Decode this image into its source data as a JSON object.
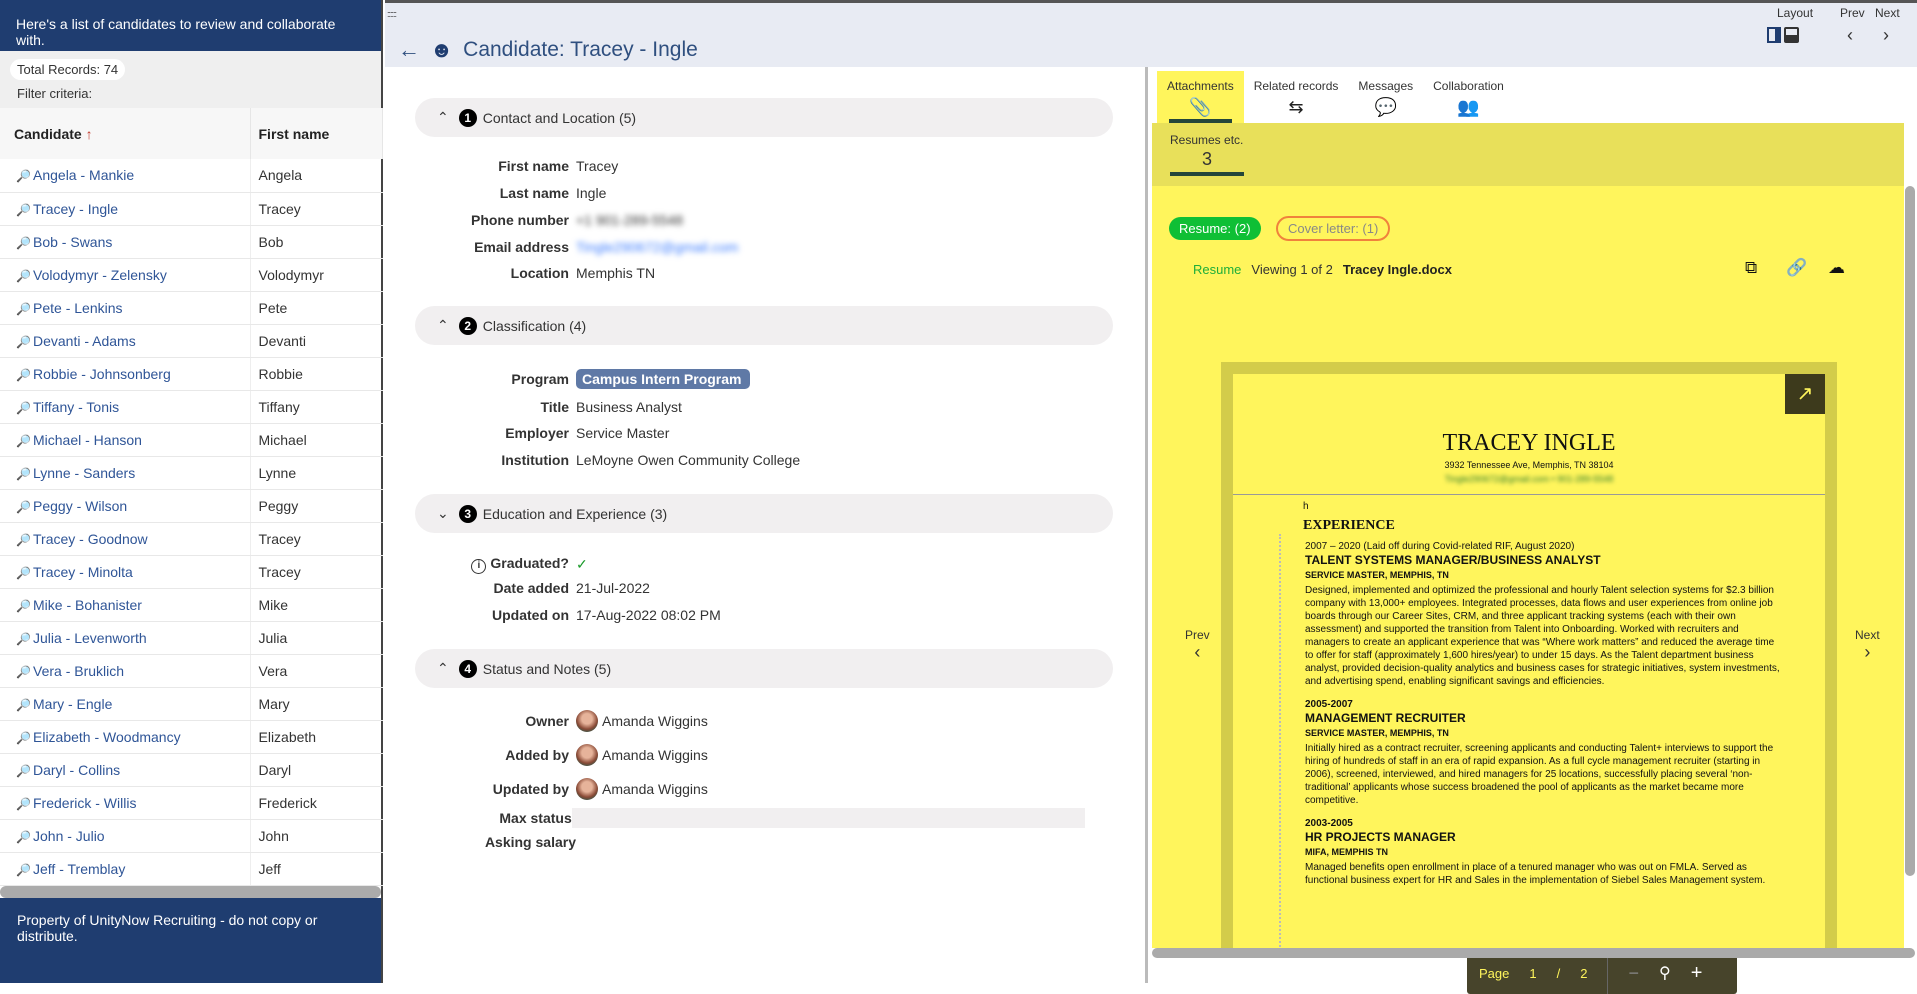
{
  "left": {
    "header": "Here's a list of candidates to review and collaborate with.",
    "total_records": "Total Records: 74",
    "filter_criteria": "Filter criteria:",
    "columns": [
      "Candidate",
      "First name"
    ],
    "sort_icon": "arrow-up",
    "rows": [
      [
        "Angela - Mankie",
        "Angela"
      ],
      [
        "Tracey - Ingle",
        "Tracey"
      ],
      [
        "Bob - Swans",
        "Bob"
      ],
      [
        "Volodymyr - Zelensky",
        "Volodymyr"
      ],
      [
        "Pete - Lenkins",
        "Pete"
      ],
      [
        "Devanti - Adams",
        "Devanti"
      ],
      [
        "Robbie - Johnsonberg",
        "Robbie"
      ],
      [
        "Tiffany - Tonis",
        "Tiffany"
      ],
      [
        "Michael - Hanson",
        "Michael"
      ],
      [
        "Lynne - Sanders",
        "Lynne"
      ],
      [
        "Peggy - Wilson",
        "Peggy"
      ],
      [
        "Tracey - Goodnow",
        "Tracey"
      ],
      [
        "Tracey - Minolta",
        "Tracey"
      ],
      [
        "Mike - Bohanister",
        "Mike"
      ],
      [
        "Julia - Levenworth",
        "Julia"
      ],
      [
        "Vera - Bruklich",
        "Vera"
      ],
      [
        "Mary - Engle",
        "Mary"
      ],
      [
        "Elizabeth - Woodmancy",
        "Elizabeth"
      ],
      [
        "Daryl - Collins",
        "Daryl"
      ],
      [
        "Frederick - Willis",
        "Frederick"
      ],
      [
        "John - Julio",
        "John"
      ],
      [
        "Jeff - Tremblay",
        "Jeff"
      ]
    ],
    "footer": "Property of UnityNow Recruiting - do not copy or distribute."
  },
  "topbar": {
    "title": "Candidate: Tracey - Ingle",
    "layout": "Layout",
    "prev": "Prev",
    "next": "Next"
  },
  "form": {
    "sections": [
      {
        "num": "1",
        "title": "Contact and Location (5)",
        "expanded": true
      },
      {
        "num": "2",
        "title": "Classification (4)",
        "expanded": true
      },
      {
        "num": "3",
        "title": "Education and Experience (3)",
        "expanded": false
      },
      {
        "num": "4",
        "title": "Status and Notes (5)",
        "expanded": true
      }
    ],
    "contact": {
      "first_name_label": "First name",
      "first_name": "Tracey",
      "last_name_label": "Last name",
      "last_name": "Ingle",
      "phone_label": "Phone number",
      "phone": "+1 901-289-5548",
      "email_label": "Email address",
      "email": "Tingle290672@gmail.com",
      "location_label": "Location",
      "location": "Memphis TN"
    },
    "classification": {
      "program_label": "Program",
      "program": "Campus Intern Program",
      "title_label": "Title",
      "title": "Business Analyst",
      "employer_label": "Employer",
      "employer": "Service Master",
      "institution_label": "Institution",
      "institution": "LeMoyne Owen Community College"
    },
    "education": {
      "graduated_label": "Graduated?",
      "graduated": "✓",
      "date_added_label": "Date added",
      "date_added": "21-Jul-2022",
      "updated_on_label": "Updated on",
      "updated_on": "17-Aug-2022 08:02 PM"
    },
    "status": {
      "owner_label": "Owner",
      "owner": "Amanda Wiggins",
      "added_by_label": "Added by",
      "added_by": "Amanda Wiggins",
      "updated_by_label": "Updated by",
      "updated_by": "Amanda Wiggins",
      "max_status_label": "Max status",
      "max_status": "",
      "asking_salary_label": "Asking salary",
      "asking_salary": ""
    }
  },
  "right": {
    "tabs": [
      "Attachments",
      "Related records",
      "Messages",
      "Collaboration"
    ],
    "active_tab": "Attachments",
    "subtab_label": "Resumes etc.",
    "subtab_count": "3",
    "pills": {
      "resume": "Resume: (2)",
      "cover": "Cover letter: (1)"
    },
    "viewer": {
      "type": "Resume",
      "viewing": "Viewing 1 of 2",
      "filename": "Tracey Ingle.docx",
      "prev": "Prev",
      "next": "Next",
      "page_label": "Page",
      "page": "1",
      "sep": "/",
      "pages": "2"
    },
    "resume": {
      "name": "TRACEY INGLE",
      "address": "3932 Tennessee Ave, Memphis, TN 38104",
      "contact": "Tingle290672@gmail.com • 901-289-5548",
      "h": "h",
      "heading": "EXPERIENCE",
      "jobs": [
        {
          "dates": "2007 – 2020 (Laid off during Covid-related RIF, August 2020)",
          "title": "TALENT SYSTEMS MANAGER/BUSINESS ANALYST",
          "company": "SERVICE MASTER, MEMPHIS, TN",
          "desc": "Designed, implemented and optimized the professional and hourly Talent selection systems for $2.3 billion company with 13,000+ employees.  Integrated processes, data flows and user experiences from online job boards through our Career Sites, CRM, and three applicant tracking systems (each with their own assessment) and supported the transition from Talent into Onboarding.  Worked with recruiters and managers to create an applicant experience that was “Where work matters” and reduced the average time to offer for staff (approximately 1,600 hires/year) to under 15 days.  As the Talent department business analyst, provided decision-quality analytics and business cases for strategic initiatives, system investments, and advertising spend, enabling significant savings and efficiencies."
        },
        {
          "dates": "2005-2007",
          "title": "MANAGEMENT RECRUITER",
          "company": "SERVICE MASTER, MEMPHIS, TN",
          "desc": "Initially hired as a contract recruiter, screening applicants and conducting Talent+ interviews to support the hiring of hundreds of staff in an era of rapid expansion.  As a full cycle management recruiter (starting in 2006), screened, interviewed, and hired managers for 25 locations, successfully placing several ‘non-traditional’ applicants whose success broadened the pool of applicants as the market became more competitive."
        },
        {
          "dates": "2003-2005",
          "title": "HR PROJECTS MANAGER",
          "company": "MIFA, MEMPHIS TN",
          "desc": "Managed benefits open enrollment in place of a tenured manager who was out on FMLA.  Served as functional business expert for HR and Sales in the implementation of Siebel Sales Management system."
        }
      ]
    }
  },
  "colors": {
    "nav_blue": "#1f3d70",
    "link_blue": "#2f5597",
    "highlight_yellow": "#fff55c",
    "band_yellow": "#e8e05a",
    "resume_green": "#0fbf35",
    "cover_orange": "#f0823c",
    "program_chip": "#5f79a6"
  }
}
